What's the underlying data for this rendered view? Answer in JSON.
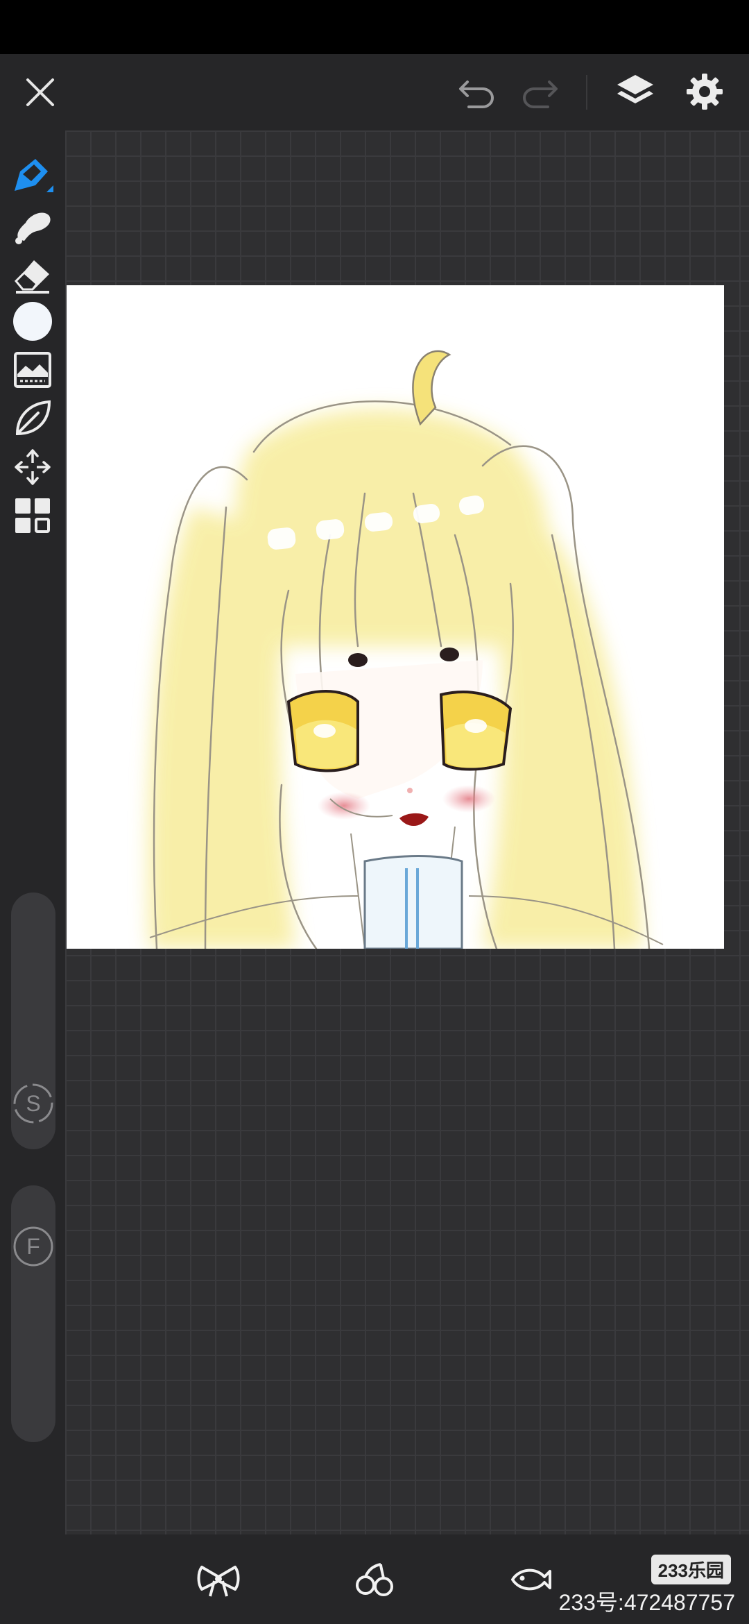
{
  "toolbar": {
    "close": "close-icon",
    "undo": "undo-icon",
    "redo": "redo-icon",
    "layers": "layers-icon",
    "settings": "gear-icon"
  },
  "tools": [
    {
      "name": "pen",
      "icon": "pen-icon",
      "active": true
    },
    {
      "name": "smudge",
      "icon": "smudge-icon"
    },
    {
      "name": "eraser",
      "icon": "eraser-icon"
    },
    {
      "name": "color",
      "icon": "color-swatch",
      "color": "#f2f6fb"
    },
    {
      "name": "image",
      "icon": "image-icon"
    },
    {
      "name": "lasso",
      "icon": "leaf-icon"
    },
    {
      "name": "transform",
      "icon": "move-icon"
    },
    {
      "name": "grid",
      "icon": "grid-icon"
    }
  ],
  "sliders": {
    "size_label": "S",
    "flow_label": "F"
  },
  "bottom_icons": [
    "bow-icon",
    "cherry-icon",
    "fish-icon"
  ],
  "watermark": {
    "logo": "233乐园",
    "id_text": "233号:472487757"
  },
  "colors": {
    "accent": "#1e8ff0",
    "background": "#2f2f31",
    "bar": "#262628"
  }
}
